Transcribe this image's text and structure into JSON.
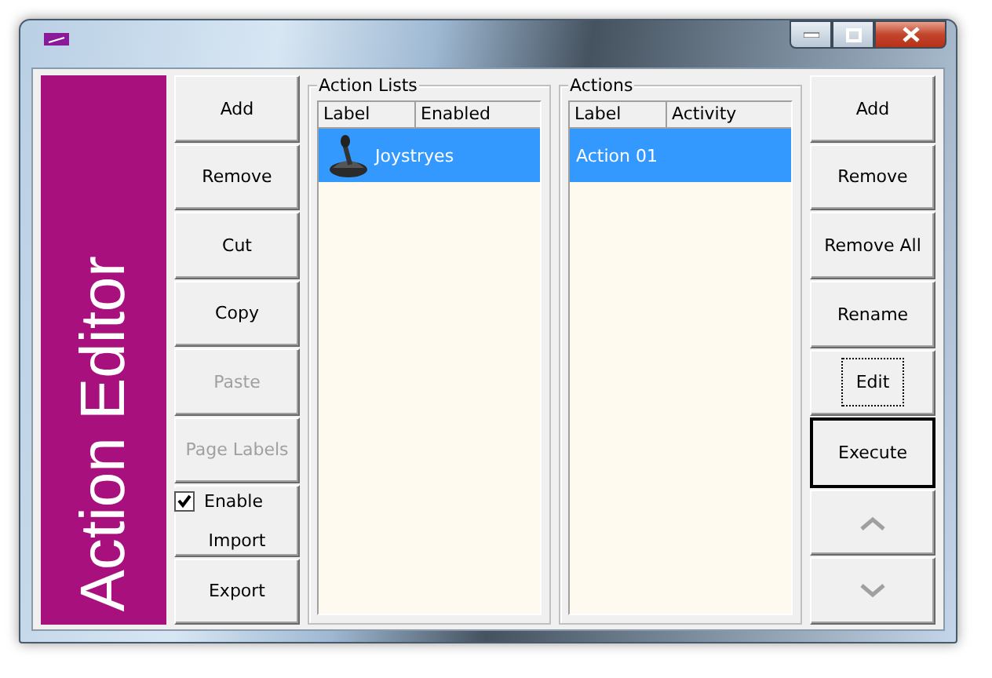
{
  "sidebar_title": "Action Editor",
  "left_buttons": [
    {
      "label": "Add",
      "disabled": false
    },
    {
      "label": "Remove",
      "disabled": false
    },
    {
      "label": "Cut",
      "disabled": false
    },
    {
      "label": "Copy",
      "disabled": false
    },
    {
      "label": "Paste",
      "disabled": true
    },
    {
      "label": "Page Labels",
      "disabled": true
    },
    {
      "label": "Import",
      "disabled": false
    },
    {
      "label": "Export",
      "disabled": false
    }
  ],
  "enable_checkbox": {
    "label": "Enable",
    "checked": true
  },
  "action_lists": {
    "title": "Action Lists",
    "columns": [
      "Label",
      "Enabled"
    ],
    "rows": [
      {
        "label": "Joystryes",
        "selected": true
      }
    ]
  },
  "actions": {
    "title": "Actions",
    "columns": [
      "Label",
      "Activity"
    ],
    "rows": [
      {
        "label": "Action 01",
        "selected": true
      }
    ]
  },
  "right_buttons": [
    {
      "kind": "text",
      "label": "Add",
      "focused": false,
      "default": false,
      "disabled": false
    },
    {
      "kind": "text",
      "label": "Remove",
      "focused": false,
      "default": false,
      "disabled": false
    },
    {
      "kind": "text",
      "label": "Remove All",
      "focused": false,
      "default": false,
      "disabled": false
    },
    {
      "kind": "text",
      "label": "Rename",
      "focused": false,
      "default": false,
      "disabled": false
    },
    {
      "kind": "text",
      "label": "Edit",
      "focused": true,
      "default": false,
      "disabled": false
    },
    {
      "kind": "text",
      "label": "Execute",
      "focused": false,
      "default": true,
      "disabled": false
    },
    {
      "kind": "up",
      "focused": false,
      "default": false,
      "disabled": true
    },
    {
      "kind": "down",
      "focused": false,
      "default": false,
      "disabled": true
    }
  ]
}
